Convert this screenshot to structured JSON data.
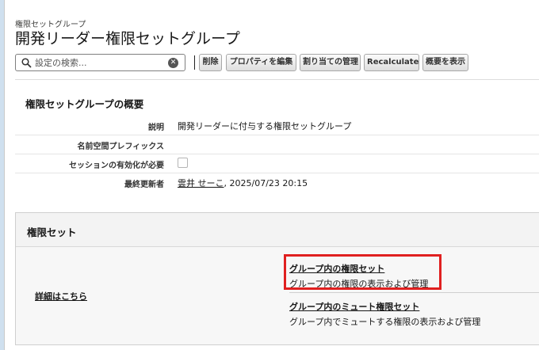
{
  "header": {
    "subtitle": "権限セットグループ",
    "title": "開発リーダー権限セットグループ"
  },
  "toolbar": {
    "search_placeholder": "設定の検索...",
    "buttons": [
      "削除",
      "プロパティを編集",
      "割り当ての管理",
      "Recalculate",
      "概要を表示"
    ]
  },
  "overview": {
    "heading": "権限セットグループの概要",
    "rows": [
      {
        "label": "説明",
        "value": "開発リーダーに付与する権限セットグループ"
      },
      {
        "label": "名前空間プレフィックス",
        "value": ""
      },
      {
        "label": "セッションの有効化が必要",
        "value": ""
      },
      {
        "label": "最終更新者",
        "user": "雲井 せーこ",
        "date": ", 2025/07/23 20:15"
      }
    ]
  },
  "permission_sets": {
    "heading": "権限セット",
    "learn_more": "詳細はこちら",
    "links": [
      {
        "title": "グループ内の権限セット",
        "desc": "グループ内の権限の表示および管理"
      },
      {
        "title": "グループ内のミュート権限セット",
        "desc": "グループ内でミュートする権限の表示および管理"
      }
    ]
  },
  "colors": {
    "highlight": "#e02020"
  }
}
